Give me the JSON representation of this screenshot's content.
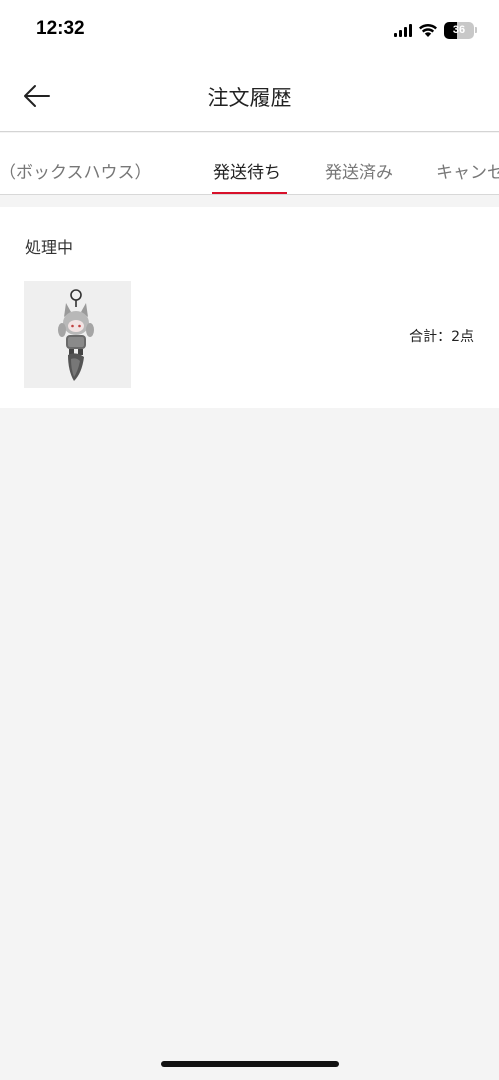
{
  "status_bar": {
    "time": "12:32",
    "battery_level": "36"
  },
  "header": {
    "title": "注文履歴"
  },
  "tabs": [
    {
      "label": "中（ボックスハウス）",
      "active": false
    },
    {
      "label": "発送待ち",
      "active": true
    },
    {
      "label": "発送済み",
      "active": false
    },
    {
      "label": "キャンセ",
      "active": false
    }
  ],
  "order": {
    "status": "処理中",
    "total": "合計：2点"
  },
  "colors": {
    "accent": "#d8102a",
    "background": "#f4f4f4",
    "card": "#ffffff"
  }
}
